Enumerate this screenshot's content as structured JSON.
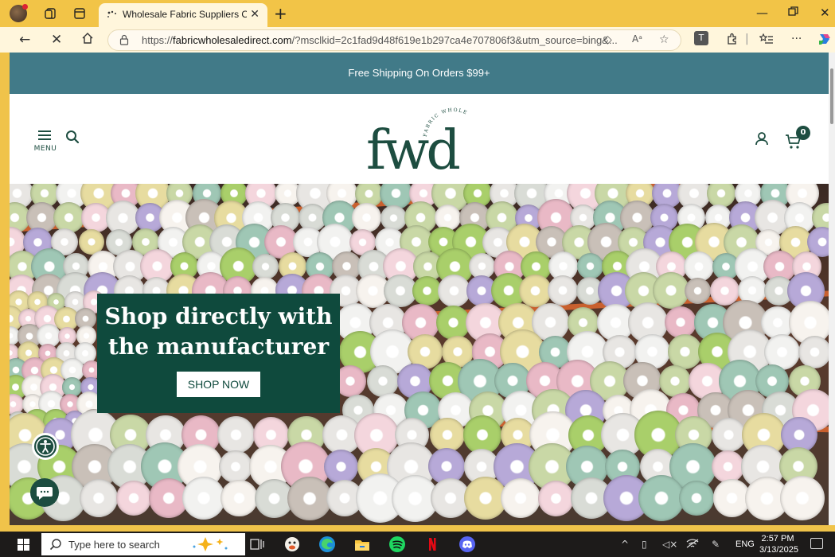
{
  "browser": {
    "tab_title": "Wholesale Fabric Suppliers Online",
    "tab_close": "✕",
    "new_tab": "+",
    "url_prefix": "https://",
    "url_domain": "fabricwholesaledirect.com",
    "url_rest": "/?msclkid=2c1fad9d48f619e1b297ca4e707806f3&utm_source=bing&...",
    "ext_letter": "T"
  },
  "site": {
    "announcement": "Free Shipping On Orders $99+",
    "menu_label": "MENU",
    "cart_count": "0",
    "logo_text": "fwd",
    "logo_ring_text": "FABRIC WHOLESALE DIRECT",
    "hero": {
      "line1": "Shop directly with",
      "line2": "the manufacturer",
      "cta": "SHOP NOW"
    }
  },
  "taskbar": {
    "search_placeholder": "Type here to search",
    "language": "ENG",
    "time": "2:57 PM",
    "date": "3/13/2025"
  },
  "colors": {
    "brand_green": "#1d4d40",
    "announcement_bg": "#417a88",
    "browser_chrome": "#f2c447"
  }
}
